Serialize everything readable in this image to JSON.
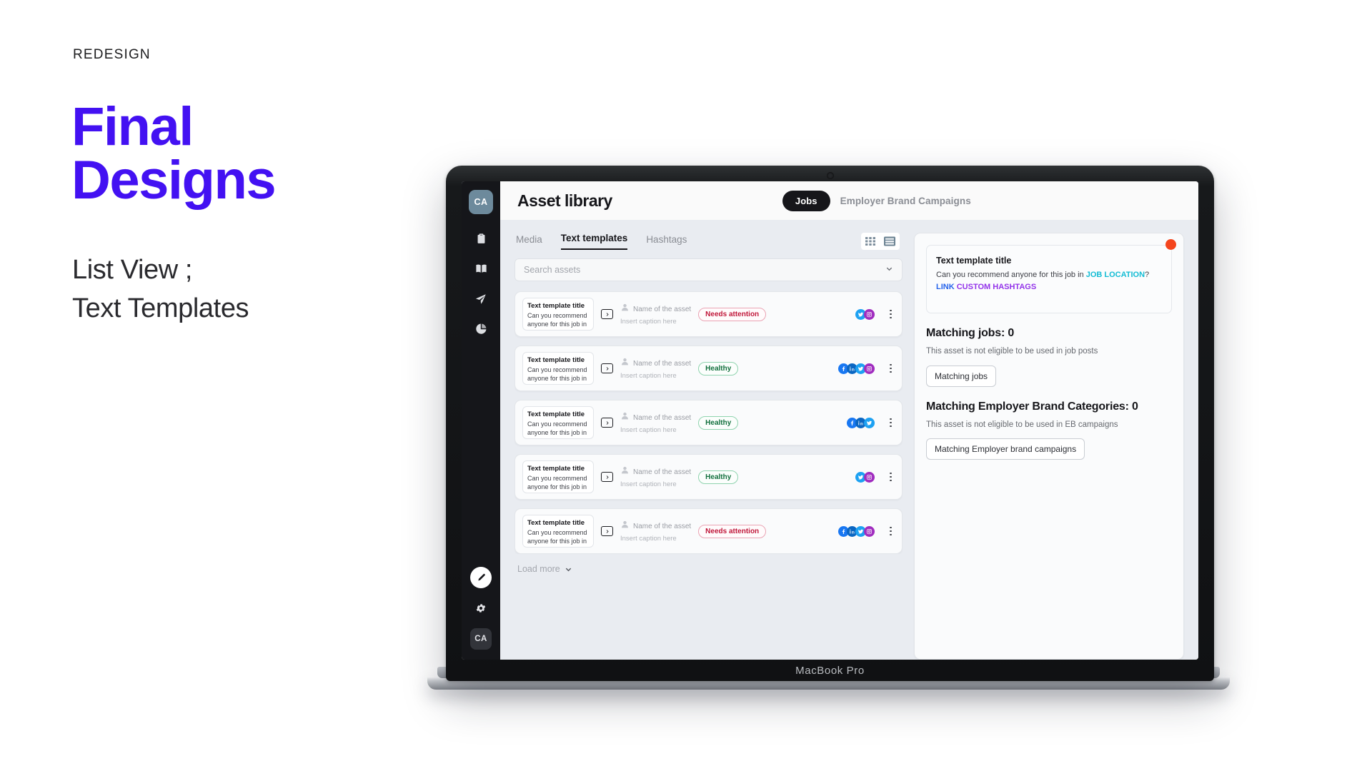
{
  "slide": {
    "eyebrow": "REDESIGN",
    "title_line1": "Final",
    "title_line2": "Designs",
    "subtitle_line1": "List View ;",
    "subtitle_line2": "Text Templates",
    "accent_color": "#4311f2"
  },
  "device": {
    "label": "MacBook Pro"
  },
  "sidebar": {
    "avatar_top": "CA",
    "avatar_bottom": "CA",
    "icons": [
      "clipboard-icon",
      "book-icon",
      "paper-plane-icon",
      "pie-chart-icon"
    ],
    "footer_icons": [
      "pen-fab-icon",
      "gear-icon"
    ]
  },
  "topbar": {
    "title": "Asset library",
    "segment_active": "Jobs",
    "segment_inactive": "Employer Brand Campaigns"
  },
  "tabs": [
    {
      "label": "Media",
      "active": false
    },
    {
      "label": "Text templates",
      "active": true
    },
    {
      "label": "Hashtags",
      "active": false
    }
  ],
  "view_toggle": {
    "grid": "grid-view-icon",
    "list": "list-view-icon",
    "active": "list"
  },
  "search": {
    "placeholder": "Search assets",
    "value": ""
  },
  "rows": [
    {
      "thumb_title": "Text template title",
      "thumb_body": "Can you recommend anyone for this job in",
      "asset_name": "Name of the asset",
      "caption": "Insert caption here",
      "status": "Needs attention",
      "status_kind": "attention",
      "socials": [
        "tw",
        "ig"
      ]
    },
    {
      "thumb_title": "Text template title",
      "thumb_body": "Can you recommend anyone for this job in",
      "asset_name": "Name of the asset",
      "caption": "Insert caption here",
      "status": "Healthy",
      "status_kind": "healthy",
      "socials": [
        "fb",
        "li",
        "tw",
        "ig"
      ]
    },
    {
      "thumb_title": "Text template title",
      "thumb_body": "Can you recommend anyone for this job in",
      "asset_name": "Name of the asset",
      "caption": "Insert caption here",
      "status": "Healthy",
      "status_kind": "healthy",
      "socials": [
        "fb",
        "li",
        "tw"
      ]
    },
    {
      "thumb_title": "Text template title",
      "thumb_body": "Can you recommend anyone for this job in",
      "asset_name": "Name of the asset",
      "caption": "Insert caption here",
      "status": "Healthy",
      "status_kind": "healthy",
      "socials": [
        "tw",
        "ig"
      ]
    },
    {
      "thumb_title": "Text template title",
      "thumb_body": "Can you recommend anyone for this job in",
      "asset_name": "Name of the asset",
      "caption": "Insert caption here",
      "status": "Needs attention",
      "status_kind": "attention",
      "socials": [
        "fb",
        "li",
        "tw",
        "ig"
      ]
    }
  ],
  "load_more": {
    "label": "Load more"
  },
  "detail": {
    "preview_title": "Text template title",
    "preview_text_plain": "Can you recommend anyone for this job in ",
    "token_location": "JOB LOCATION",
    "preview_text_mid": "? ",
    "token_link": "LINK",
    "token_hashtags": "CUSTOM HASHTAGS",
    "badge": "notification-dot",
    "jobs_heading": "Matching jobs: 0",
    "jobs_desc": "This asset is not eligible to be used in job posts",
    "jobs_button": "Matching jobs",
    "eb_heading": "Matching Employer Brand Categories: 0",
    "eb_desc": "This asset is not eligible to be used in EB campaigns",
    "eb_button": "Matching Employer brand campaigns"
  }
}
